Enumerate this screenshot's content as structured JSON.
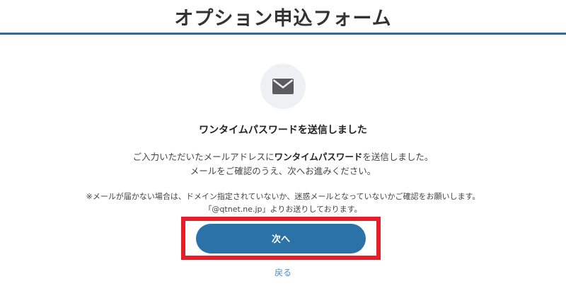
{
  "header": {
    "title": "オプション申込フォーム"
  },
  "main": {
    "icon": "mail-icon",
    "heading": "ワンタイムパスワードを送信しました",
    "description": {
      "line1_before": "ご入力いただいたメールアドレスに",
      "line1_bold": "ワンタイムパスワード",
      "line1_after": "を送信しました。",
      "line2": "メールをご確認のうえ、次へお進みください。"
    },
    "note": {
      "line1": "※メールが届かない場合は、ドメイン指定されていないか、迷惑メールとなっていないかご確認をお願いします。",
      "line2": "「@qtnet.ne.jp」よりお送りしております。"
    },
    "next_label": "次へ",
    "back_label": "戻る"
  },
  "colors": {
    "accent": "#2a72a8",
    "header_rule": "#2b6aa3",
    "highlight": "#e61e2a",
    "link": "#4a90c9"
  }
}
